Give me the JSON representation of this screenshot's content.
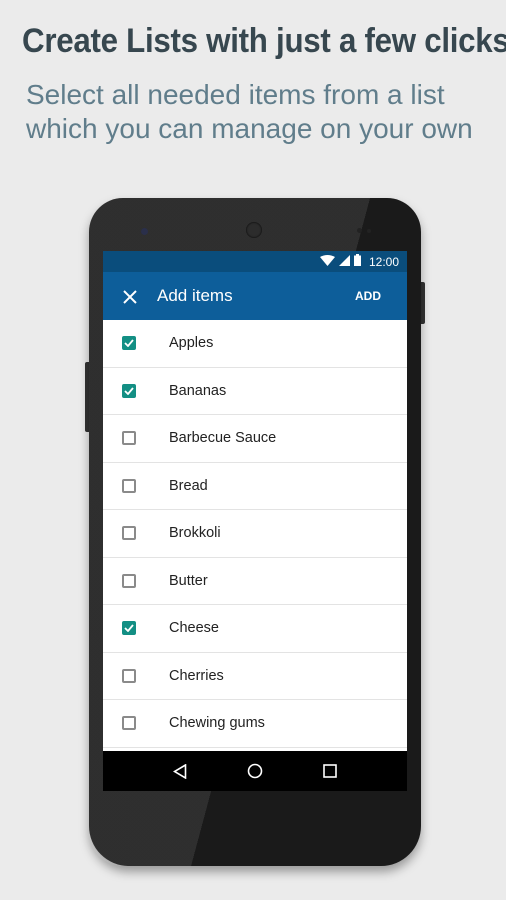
{
  "headline": "Create Lists with just a few clicks",
  "subtitle": {
    "line1": "Select all needed items from a list",
    "line2": "which you can manage on your own"
  },
  "status_bar": {
    "time": "12:00",
    "icons": [
      "wifi-icon",
      "signal-icon",
      "battery-icon"
    ]
  },
  "app_bar": {
    "close_icon": "close-icon",
    "title": "Add items",
    "action_label": "ADD"
  },
  "colors": {
    "primary": "#0d5e9a",
    "status_bar": "#0a4d7c",
    "accent": "#138f84"
  },
  "items": [
    {
      "label": "Apples",
      "checked": true
    },
    {
      "label": "Bananas",
      "checked": true
    },
    {
      "label": "Barbecue Sauce",
      "checked": false
    },
    {
      "label": "Bread",
      "checked": false
    },
    {
      "label": "Brokkoli",
      "checked": false
    },
    {
      "label": "Butter",
      "checked": false
    },
    {
      "label": "Cheese",
      "checked": true
    },
    {
      "label": "Cherries",
      "checked": false
    },
    {
      "label": "Chewing gums",
      "checked": false
    }
  ],
  "nav_bar": [
    "back-icon",
    "home-icon",
    "recents-icon"
  ]
}
